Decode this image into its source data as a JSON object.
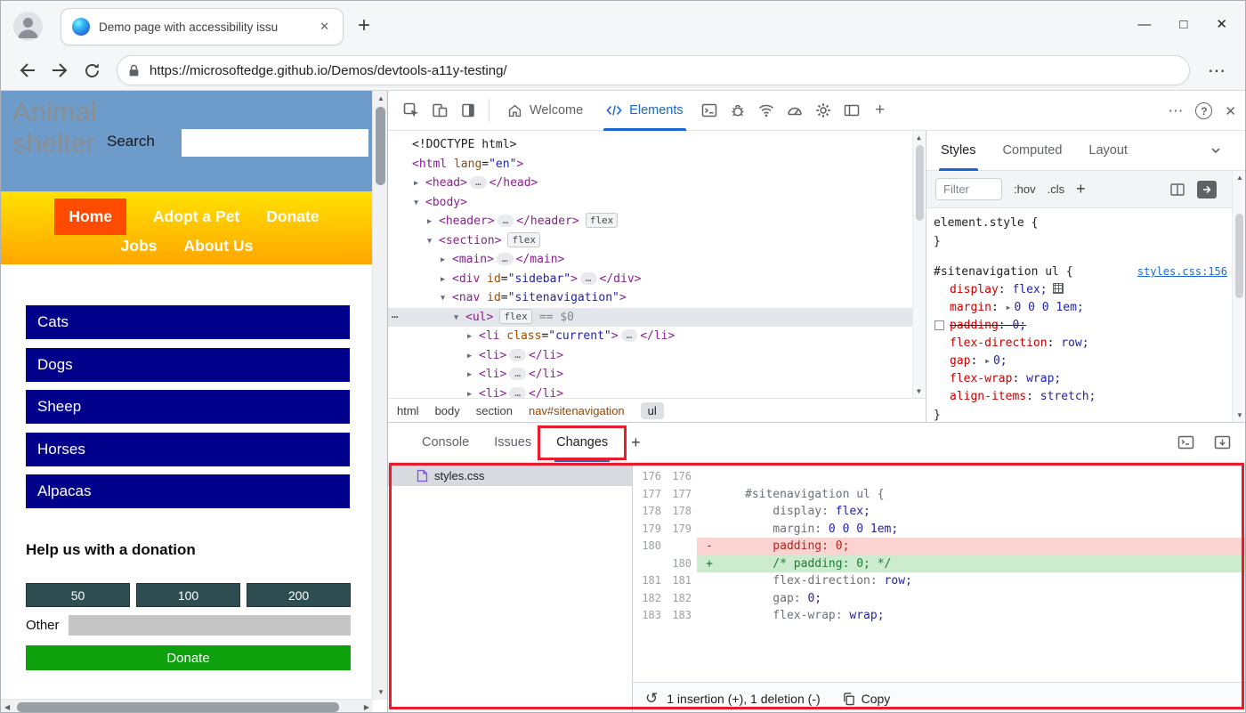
{
  "colors": {
    "accent": "#1967d2",
    "annotation_red": "#ea1b2d",
    "header_blue": "#6e9cca",
    "nav_current": "#ff4b00",
    "sidebar_navy": "#00008b",
    "donate_green": "#0da10d",
    "diff_add_bg": "#cdeccf",
    "diff_del_bg": "#fbd3d0"
  },
  "icons": {
    "minimize": "—",
    "maximize": "□",
    "close": "✕",
    "tab_close": "✕",
    "new_tab": "+",
    "browser_more": "⋯",
    "devtools_more": "⋯",
    "help": "?",
    "devtools_close": "✕",
    "drawer_new_tab": "+",
    "revert": "↺",
    "expander_open": "▼",
    "expander_closed": "▶",
    "gutter_more": "⋯",
    "scroll_up": "▲",
    "scroll_down": "▼",
    "scroll_left": "◀",
    "scroll_right": "▶"
  },
  "browser": {
    "tab_title": "Demo page with accessibility issu",
    "url": "https://microsoftedge.github.io/Demos/devtools-a11y-testing/"
  },
  "page": {
    "title": "Animal shelter",
    "search_label": "Search",
    "nav_items": [
      {
        "label": "Home",
        "current": true
      },
      {
        "label": "Adopt a Pet",
        "current": false
      },
      {
        "label": "Donate",
        "current": false
      },
      {
        "label": "Jobs",
        "current": false
      },
      {
        "label": "About Us",
        "current": false
      }
    ],
    "sidebar_items": [
      "Cats",
      "Dogs",
      "Sheep",
      "Horses",
      "Alpacas"
    ],
    "donation_heading": "Help us with a donation",
    "donation_amounts": [
      "50",
      "100",
      "200"
    ],
    "other_label": "Other",
    "donate_label": "Donate"
  },
  "devtools": {
    "toolbar_tabs": {
      "welcome": "Welcome",
      "elements": "Elements"
    },
    "elements_tree": [
      {
        "depth": 0,
        "tokens": [
          {
            "c": "doctype",
            "t": "<!DOCTYPE html>"
          }
        ]
      },
      {
        "depth": 0,
        "tokens": [
          {
            "c": "tag",
            "t": "<html"
          },
          {
            "c": "attr",
            "t": " lang"
          },
          {
            "c": "plain",
            "t": "="
          },
          {
            "c": "val",
            "t": "\"en\""
          },
          {
            "c": "tag",
            "t": ">"
          }
        ]
      },
      {
        "depth": 1,
        "arrow": "closed",
        "tokens": [
          {
            "c": "tag",
            "t": "<head>"
          },
          {
            "c": "ell",
            "t": "…"
          },
          {
            "c": "tag",
            "t": "</head>"
          }
        ]
      },
      {
        "depth": 1,
        "arrow": "open",
        "tokens": [
          {
            "c": "tag",
            "t": "<body>"
          }
        ]
      },
      {
        "depth": 2,
        "arrow": "closed",
        "tokens": [
          {
            "c": "tag",
            "t": "<header>"
          },
          {
            "c": "ell",
            "t": "…"
          },
          {
            "c": "tag",
            "t": "</header>"
          },
          {
            "c": "badge",
            "t": "flex"
          }
        ]
      },
      {
        "depth": 2,
        "arrow": "open",
        "tokens": [
          {
            "c": "tag",
            "t": "<section>"
          },
          {
            "c": "badge",
            "t": "flex"
          }
        ]
      },
      {
        "depth": 3,
        "arrow": "closed",
        "tokens": [
          {
            "c": "tag",
            "t": "<main>"
          },
          {
            "c": "ell",
            "t": "…"
          },
          {
            "c": "tag",
            "t": "</main>"
          }
        ]
      },
      {
        "depth": 3,
        "arrow": "closed",
        "tokens": [
          {
            "c": "tag",
            "t": "<div"
          },
          {
            "c": "attr",
            "t": " id"
          },
          {
            "c": "plain",
            "t": "="
          },
          {
            "c": "val",
            "t": "\"sidebar\""
          },
          {
            "c": "tag",
            "t": ">"
          },
          {
            "c": "ell",
            "t": "…"
          },
          {
            "c": "tag",
            "t": "</div>"
          }
        ]
      },
      {
        "depth": 3,
        "arrow": "open",
        "tokens": [
          {
            "c": "tag",
            "t": "<nav"
          },
          {
            "c": "attr",
            "t": " id"
          },
          {
            "c": "plain",
            "t": "="
          },
          {
            "c": "val",
            "t": "\"sitenavigation\""
          },
          {
            "c": "tag",
            "t": ">"
          }
        ]
      },
      {
        "depth": 4,
        "arrow": "open",
        "selected": true,
        "gutter": true,
        "tokens": [
          {
            "c": "tag",
            "t": "<ul>"
          },
          {
            "c": "badge",
            "t": "flex"
          },
          {
            "c": "eq",
            "t": "== $0"
          }
        ]
      },
      {
        "depth": 5,
        "arrow": "closed",
        "tokens": [
          {
            "c": "tag",
            "t": "<li"
          },
          {
            "c": "attr",
            "t": " class"
          },
          {
            "c": "plain",
            "t": "="
          },
          {
            "c": "val",
            "t": "\"current\""
          },
          {
            "c": "tag",
            "t": ">"
          },
          {
            "c": "ell",
            "t": "…"
          },
          {
            "c": "tag",
            "t": "</li>"
          }
        ]
      },
      {
        "depth": 5,
        "arrow": "closed",
        "tokens": [
          {
            "c": "tag",
            "t": "<li>"
          },
          {
            "c": "ell",
            "t": "…"
          },
          {
            "c": "tag",
            "t": "</li>"
          }
        ]
      },
      {
        "depth": 5,
        "arrow": "closed",
        "tokens": [
          {
            "c": "tag",
            "t": "<li>"
          },
          {
            "c": "ell",
            "t": "…"
          },
          {
            "c": "tag",
            "t": "</li>"
          }
        ]
      },
      {
        "depth": 5,
        "arrow": "closed",
        "tokens": [
          {
            "c": "tag",
            "t": "<li>"
          },
          {
            "c": "ell",
            "t": "…"
          },
          {
            "c": "tag",
            "t": "</li>"
          }
        ]
      }
    ],
    "breadcrumbs": [
      {
        "label": "html",
        "state": "normal"
      },
      {
        "label": "body",
        "state": "normal"
      },
      {
        "label": "section",
        "state": "normal"
      },
      {
        "label": "nav#sitenavigation",
        "state": "highlight"
      },
      {
        "label": "ul",
        "state": "selected"
      }
    ],
    "styles_pane": {
      "tabs": [
        "Styles",
        "Computed",
        "Layout"
      ],
      "filter_placeholder": "Filter",
      "pseudo_toggle": ":hov",
      "class_toggle": ".cls",
      "new_rule": "+",
      "element_style": {
        "selector": "element.style",
        "open": "{",
        "close": "}"
      },
      "rule": {
        "selector": "#sitenavigation ul",
        "open": "{",
        "close": "}",
        "link": "styles.css:156",
        "props": [
          {
            "name": "display",
            "value": "flex",
            "icon": "flex-editor"
          },
          {
            "name": "margin",
            "value": "0 0 0 1em",
            "arrow": true
          },
          {
            "name": "padding",
            "value": "0",
            "disabled": true
          },
          {
            "name": "flex-direction",
            "value": "row"
          },
          {
            "name": "gap",
            "value": "0",
            "arrow": true
          },
          {
            "name": "flex-wrap",
            "value": "wrap"
          },
          {
            "name": "align-items",
            "value": "stretch"
          }
        ]
      }
    },
    "drawer": {
      "tabs": [
        "Console",
        "Issues",
        "Changes"
      ]
    },
    "changes": {
      "file": "styles.css",
      "diff": [
        {
          "old": "176",
          "new": "176",
          "type": "ctx",
          "segments": []
        },
        {
          "old": "177",
          "new": "177",
          "type": "ctx",
          "segments": [
            {
              "t": "#sitenavigation ul {",
              "c": "sel"
            }
          ]
        },
        {
          "old": "178",
          "new": "178",
          "type": "ctx",
          "segments": [
            {
              "t": "    display: ",
              "c": "prop"
            },
            {
              "t": "flex;",
              "c": "val"
            }
          ]
        },
        {
          "old": "179",
          "new": "179",
          "type": "ctx",
          "segments": [
            {
              "t": "    margin: ",
              "c": "prop"
            },
            {
              "t": "0 0 0 1em;",
              "c": "val"
            }
          ]
        },
        {
          "old": "180",
          "new": "",
          "type": "del",
          "segments": [
            {
              "t": "    padding: ",
              "c": "delname"
            },
            {
              "t": "0;",
              "c": "delval"
            }
          ]
        },
        {
          "old": "",
          "new": "180",
          "type": "add",
          "segments": [
            {
              "t": "    /* padding: 0; */",
              "c": "comment"
            }
          ]
        },
        {
          "old": "181",
          "new": "181",
          "type": "ctx",
          "segments": [
            {
              "t": "    flex-direction: ",
              "c": "prop"
            },
            {
              "t": "row;",
              "c": "val"
            }
          ]
        },
        {
          "old": "182",
          "new": "182",
          "type": "ctx",
          "segments": [
            {
              "t": "    gap: ",
              "c": "prop"
            },
            {
              "t": "0;",
              "c": "val"
            }
          ]
        },
        {
          "old": "183",
          "new": "183",
          "type": "ctx",
          "segments": [
            {
              "t": "    flex-wrap: ",
              "c": "prop"
            },
            {
              "t": "wrap;",
              "c": "val"
            }
          ]
        }
      ],
      "summary": "1 insertion (+), 1 deletion (-)",
      "copy_label": "Copy"
    }
  }
}
